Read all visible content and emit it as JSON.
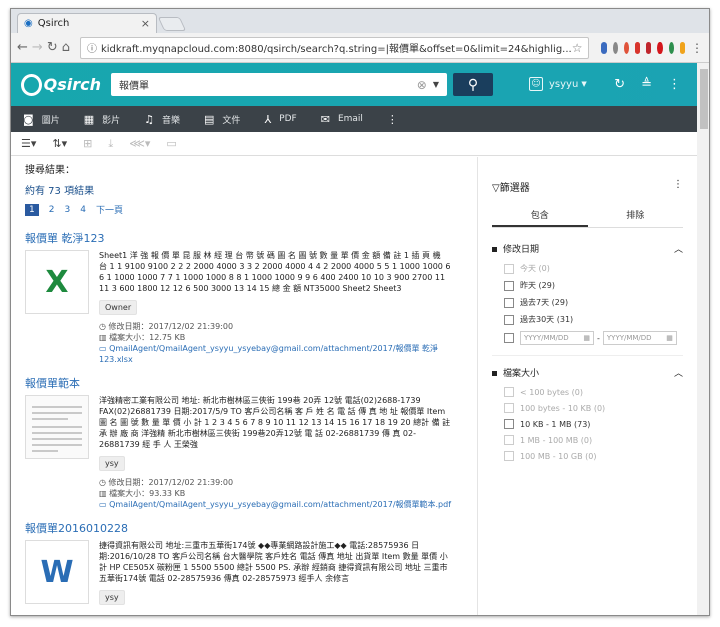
{
  "browser": {
    "tab_title": "Qsirch",
    "url": "kidkraft.myqnapcloud.com:8080/qsirch/search?q.string=|報價單&offset=0&limit=24&highlig..."
  },
  "app": {
    "logo": "Qsirch",
    "search_value": "報價單",
    "user": "ysyyu"
  },
  "nav": {
    "items": [
      {
        "icon": "camera-icon",
        "label": "圖片"
      },
      {
        "icon": "film-icon",
        "label": "影片"
      },
      {
        "icon": "music-icon",
        "label": "音樂"
      },
      {
        "icon": "document-icon",
        "label": "文件"
      },
      {
        "icon": "pdf-icon",
        "label": "PDF"
      },
      {
        "icon": "mail-icon",
        "label": "Email"
      }
    ]
  },
  "results": {
    "header": "搜尋結果：",
    "count": "約有 73 項結果",
    "pages": [
      "1",
      "2",
      "3",
      "4"
    ],
    "next": "下一頁",
    "meta_modified_label": "修改日期：",
    "meta_size_label": "檔案大小：",
    "items": [
      {
        "title": "報價單 乾淨123",
        "type": "X",
        "snippet": "Sheet1 洋 強 報 價 單 昆 服 林 經 理 台 幣 號 碼 圖 名 圖 號 數 量 單 價 金 額 備 註 1 插 頁 機 台 1 1 9100 9100 2 2 2 2000 4000 3 3 2 2000 4000 4 4 2 2000 4000 5 5 1 1000 1000 6 6 1 1000 1000 7 7 1 1000 1000 8 8 1 1000 1000 9 9 6 400 2400 10 10 3 900 2700 11 11 3 600 1800 12 12 6 500 3000 13 14 15 總 金 額 NT35000 Sheet2 Sheet3",
        "badge": "Owner",
        "modified": "2017/12/02 21:39:00",
        "size": "12.75 KB",
        "path": "QmailAgent/QmailAgent_ysyyu_ysyebay@gmail.com/attachment/2017/報價單 乾淨123.xlsx"
      },
      {
        "title": "報價單範本",
        "type": "doc",
        "snippet": "洋強精密工業有限公司 地址: 新北市樹林區三俠街 199巷 20弄 12號 電話(02)2688-1739 FAX(02)26881739 日期:2017/5/9 TO 客戶公司名稱 客 戶 姓 名 電 話 傳 真 地 址 報價單 Item 圖 名 圖 號 數 量 單 價 小 計 1 2 3 4 5 6 7 8 9 10 11 12 13 14 15 16 17 18 19 20 總計 備 註 承 辦 廠 商 洋強精 新北市樹林區三俠街 199巷20弄12號 電 話 02-26881739 傳 真 02-26881739 經 手 人 王榮強",
        "badge": "ysy",
        "modified": "2017/12/02 21:39:00",
        "size": "93.33 KB",
        "path": "QmailAgent/QmailAgent_ysyyu_ysyebay@gmail.com/attachment/2017/報價單範本.pdf"
      },
      {
        "title": "報價單2016010228",
        "type": "W",
        "snippet": "捷得資訊有限公司 地址:三重市五華街174號 ◆◆專業網路設計施工◆◆ 電話:28575936 日期:2016/10/28 TO 客戶公司名稱 台大醫學院 客戶姓名 電話 傳真 地址 出貨單 Item 數量 單價 小計 HP CE505X 碳粉匣 1 5500 5500 總計 5500 PS. 承辦 經銷商 捷得資訊有限公司 地址 三重市五華街174號 電話 02-28575936 傳真 02-28575973 經手人 余修言",
        "badge": "ysy"
      }
    ]
  },
  "filter": {
    "title": "篩選器",
    "tab_include": "包含",
    "tab_exclude": "排除",
    "date_section": "修改日期",
    "date_options": [
      {
        "label": "今天",
        "count": "(0)",
        "enabled": false
      },
      {
        "label": "昨天",
        "count": "(29)",
        "enabled": true
      },
      {
        "label": "過去7天",
        "count": "(29)",
        "enabled": true
      },
      {
        "label": "過去30天",
        "count": "(31)",
        "enabled": true
      }
    ],
    "date_from_placeholder": "YYYY/MM/DD",
    "date_to_placeholder": "YYYY/MM/DD",
    "date_sep": "-",
    "size_section": "檔案大小",
    "size_options": [
      {
        "label": "< 100 bytes",
        "count": "(0)",
        "enabled": false
      },
      {
        "label": "100 bytes - 10 KB",
        "count": "(0)",
        "enabled": false
      },
      {
        "label": "10 KB - 1 MB",
        "count": "(73)",
        "enabled": true
      },
      {
        "label": "1 MB - 100 MB",
        "count": "(0)",
        "enabled": false
      },
      {
        "label": "100 MB - 10 GB",
        "count": "(0)",
        "enabled": false
      }
    ]
  }
}
